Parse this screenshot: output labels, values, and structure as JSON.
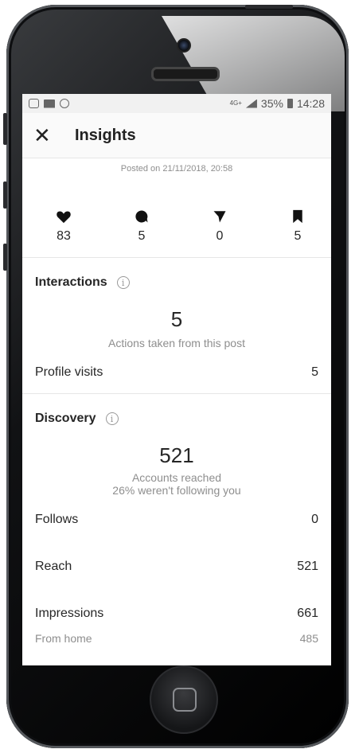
{
  "status": {
    "network": "4G+",
    "battery": "35%",
    "time": "14:28",
    "left_icons": [
      "instagram-icon",
      "mail-icon",
      "at-icon"
    ]
  },
  "header": {
    "title": "Insights",
    "close_icon": "close-icon"
  },
  "post": {
    "posted": "Posted on 21/11/2018, 20:58"
  },
  "stats": [
    {
      "icon": "heart-icon",
      "value": "83"
    },
    {
      "icon": "comment-icon",
      "value": "5"
    },
    {
      "icon": "send-icon",
      "value": "0"
    },
    {
      "icon": "bookmark-icon",
      "value": "5"
    }
  ],
  "interactions": {
    "title": "Interactions",
    "total": "5",
    "caption": "Actions taken from this post",
    "rows": [
      {
        "label": "Profile visits",
        "value": "5"
      }
    ]
  },
  "discovery": {
    "title": "Discovery",
    "total": "521",
    "caption1": "Accounts reached",
    "caption2": "26% weren't following you",
    "rows": [
      {
        "label": "Follows",
        "value": "0"
      },
      {
        "label": "Reach",
        "value": "521"
      },
      {
        "label": "Impressions",
        "value": "661"
      }
    ],
    "sub_rows": [
      {
        "label": "From home",
        "value": "485"
      }
    ]
  },
  "colors": {
    "text": "#262626",
    "muted": "#8e8e8e",
    "divider": "#e6e6e6"
  }
}
